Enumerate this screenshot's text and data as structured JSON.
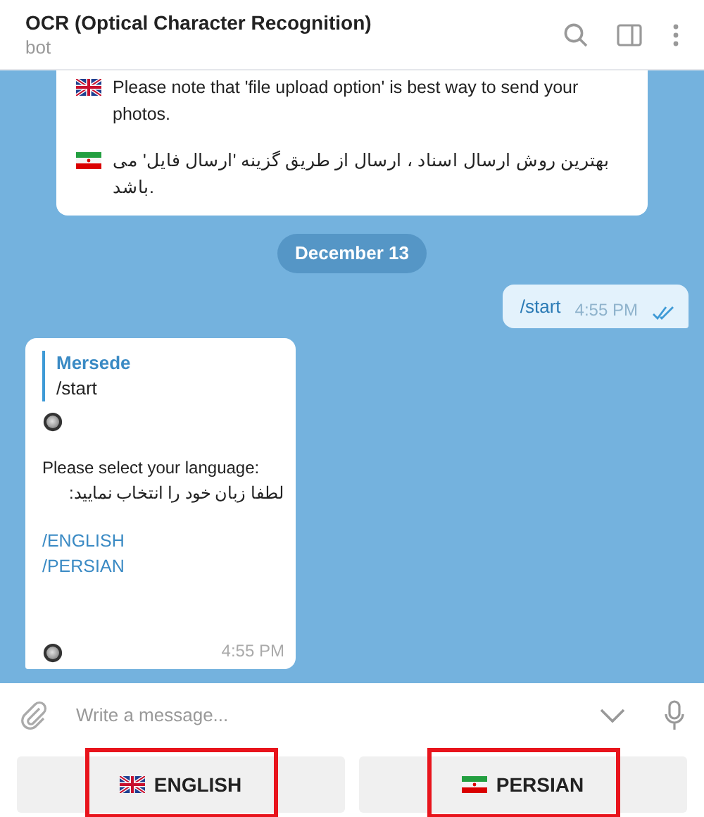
{
  "header": {
    "title": "OCR (Optical Character Recognition)",
    "subtitle": "bot"
  },
  "messages": [
    {
      "kind": "notice",
      "paragraphs": [
        {
          "kind": "uk-flag",
          "text": "Please note that 'file upload option' is best way to send your photos."
        },
        {
          "kind": "iran-flag",
          "text": "بهترین روش ارسال اسناد ، ارسال از طریق گزینه 'ارسال فایل' می باشد."
        }
      ]
    },
    {
      "kind": "date",
      "text": "December 13"
    },
    {
      "kind": "outgoing",
      "text": "/start",
      "time": "4:55 PM",
      "read": true
    },
    {
      "kind": "incoming",
      "reply": {
        "author": "Mersede",
        "text": "/start"
      },
      "lines": [
        "Please select your language:",
        "لطفا زبان خود را انتخاب نمایید:"
      ],
      "commands": [
        "/ENGLISH",
        "/PERSIAN"
      ],
      "time": "4:55 PM"
    }
  ],
  "composer": {
    "placeholder": "Write a message..."
  },
  "keyboard": [
    {
      "kind": "uk-flag",
      "label": "ENGLISH",
      "highlighted": true
    },
    {
      "kind": "iran-flag",
      "label": "PERSIAN",
      "highlighted": true
    }
  ]
}
